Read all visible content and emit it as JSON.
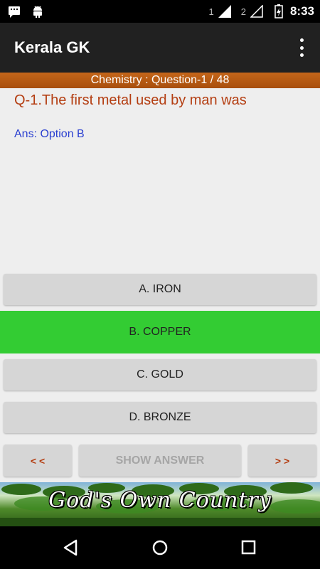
{
  "status_bar": {
    "sim1": "1",
    "sim2": "2",
    "time": "8:33"
  },
  "app_bar": {
    "title": "Kerala GK",
    "menu_icon": "overflow-menu-icon"
  },
  "quiz": {
    "header": "Chemistry : Question-1 / 48",
    "question": "Q-1.The first metal used by man was",
    "answer": "Ans: Option B",
    "options": [
      {
        "label": "A. IRON",
        "correct": false
      },
      {
        "label": "B. COPPER",
        "correct": true
      },
      {
        "label": "C. GOLD",
        "correct": false
      },
      {
        "label": "D. BRONZE",
        "correct": false
      }
    ],
    "prev_label": "< <",
    "show_answer_label": "SHOW ANSWER",
    "next_label": "> >",
    "correct_color": "#33cc33"
  },
  "banner": {
    "text": "God's Own Country"
  },
  "nav_bar": {
    "back_icon": "back-icon",
    "home_icon": "home-icon",
    "recents_icon": "recents-icon"
  }
}
